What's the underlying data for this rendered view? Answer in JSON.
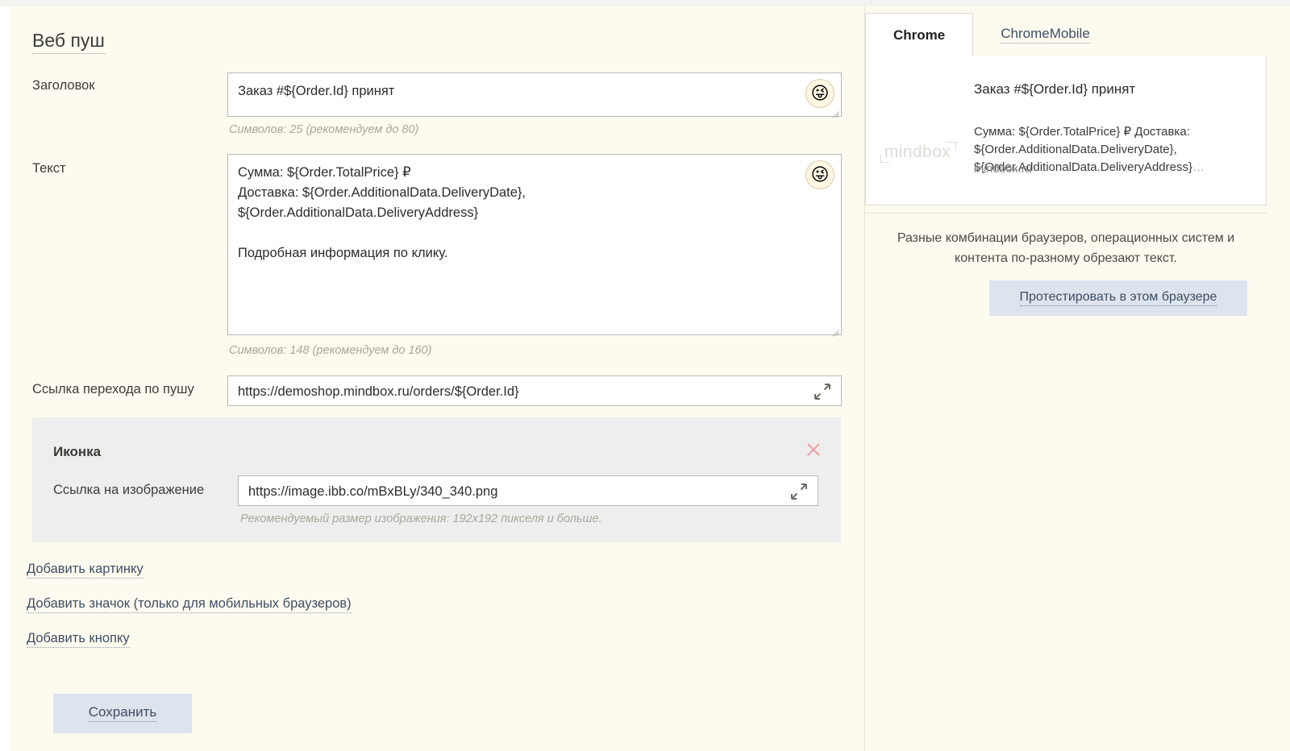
{
  "form": {
    "section_title": "Веб пуш",
    "fields": {
      "title": {
        "label": "Заголовок",
        "value": "Заказ #${Order.Id} принят",
        "hint": "Символов: 25 (рекомендуем до 80)",
        "emoji": "😜"
      },
      "text": {
        "label": "Текст",
        "value": "Сумма: ${Order.TotalPrice} ₽\nДоставка: ${Order.AdditionalData.DeliveryDate},\n${Order.AdditionalData.DeliveryAddress}\n\nПодробная информация по клику.",
        "hint": "Символов: 148 (рекомендуем до 160)",
        "emoji": "😜"
      },
      "push_link": {
        "label": "Ссылка перехода по пушу",
        "value": "https://demoshop.mindbox.ru/orders/${Order.Id}"
      }
    },
    "icon_block": {
      "title": "Иконка",
      "image_link_label": "Ссылка на изображение",
      "image_link_value": "https://image.ibb.co/mBxBLy/340_340.png",
      "hint": "Рекомендуемый размер изображения: 192x192 пикселя и больше.",
      "close_label": "×"
    },
    "add_links": [
      {
        "label": "Добавить картинку"
      },
      {
        "label": "Добавить значок (только для мобильных браузеров)"
      },
      {
        "label": "Добавить кнопку"
      }
    ],
    "save_label": "Сохранить"
  },
  "preview": {
    "tabs": [
      {
        "label": "Chrome",
        "active": true
      },
      {
        "label": "ChromeMobile",
        "active": false
      }
    ],
    "logo_text": "mindbox",
    "notification": {
      "title": "Заказ #${Order.Id} принят",
      "body": "Сумма: ${Order.TotalPrice} ₽ Доставка:\n${Order.AdditionalData.DeliveryDate},\n${Order.AdditionalData.DeliveryAddress}",
      "ellipsis": "…",
      "domain": "mindbox.ru"
    },
    "note": "Разные комбинации браузеров, операционных систем и контента по-разному обрезают текст.",
    "test_button_label": "Протестировать в этом браузере"
  },
  "colors": {
    "page_bg": "#fdfaf0",
    "accent_button": "#dde4ee",
    "link": "#3f4f63",
    "close_x": "#eda0a8",
    "icon_block_bg": "#eeeeee"
  }
}
